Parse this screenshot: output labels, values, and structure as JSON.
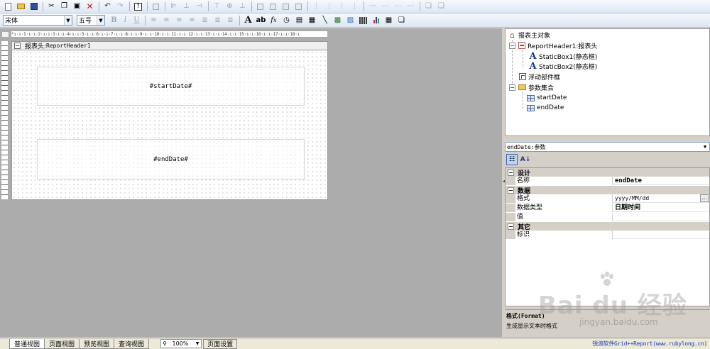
{
  "toolbar": {
    "font_name": "宋体",
    "font_size": "五号"
  },
  "designer": {
    "ruler_text": "¹ı·ı·1·ı·ı·2·ı·ı·3·ı·ı·4·ı·ı·5·ı·ı·6·ı·ı·7·ı·ı·8·ı·ı·9·ı·ı·10·ı·ı·11·ı·ı·12·ı·ı·13·ı·ı·14·ı·ı·15·ı·ı·16·ı·ı·17·ı·ı·18·ı",
    "band_label": "报表头:",
    "band_name": "ReportHeader1",
    "box1_text": "#startDate#",
    "box2_text": "#endDate#"
  },
  "tree": {
    "root": "报表主对象",
    "report_header": "ReportHeader1:报表头",
    "static_box1": "StaticBox1(静态框)",
    "static_box2": "StaticBox2(静态框)",
    "float_controls": "浮动部件框",
    "parameters": "参数集合",
    "param_start": "startDate",
    "param_end": "endDate"
  },
  "properties": {
    "selected_object": "endDate:参数",
    "categories": {
      "design": "设计",
      "data": "数据",
      "other": "其它"
    },
    "rows": {
      "name_label": "名称",
      "name_value": "endDate",
      "format_label": "格式",
      "format_value": "yyyy/MM/dd",
      "datatype_label": "数据类型",
      "datatype_value": "日期时间",
      "value_label": "值",
      "tag_label": "标识"
    },
    "ellipsis": "...",
    "description_title": "格式(Format)",
    "description_text": "生成显示文本时格式"
  },
  "watermark": {
    "main": "Bai du 经验",
    "sub": "jingyan.baidu.com"
  },
  "bottom": {
    "tabs": [
      "普通视图",
      "页面视图",
      "预览视图",
      "查询视图"
    ],
    "zoom": "100%",
    "page_setup": "页面设置",
    "footer_link": "锐浪软件Grid++Report(www.rubylong.cn)"
  },
  "colors": {
    "workspace_bg": "#acacac",
    "footer_link": "#1d3fb4",
    "selection": "#c1d2ee"
  }
}
